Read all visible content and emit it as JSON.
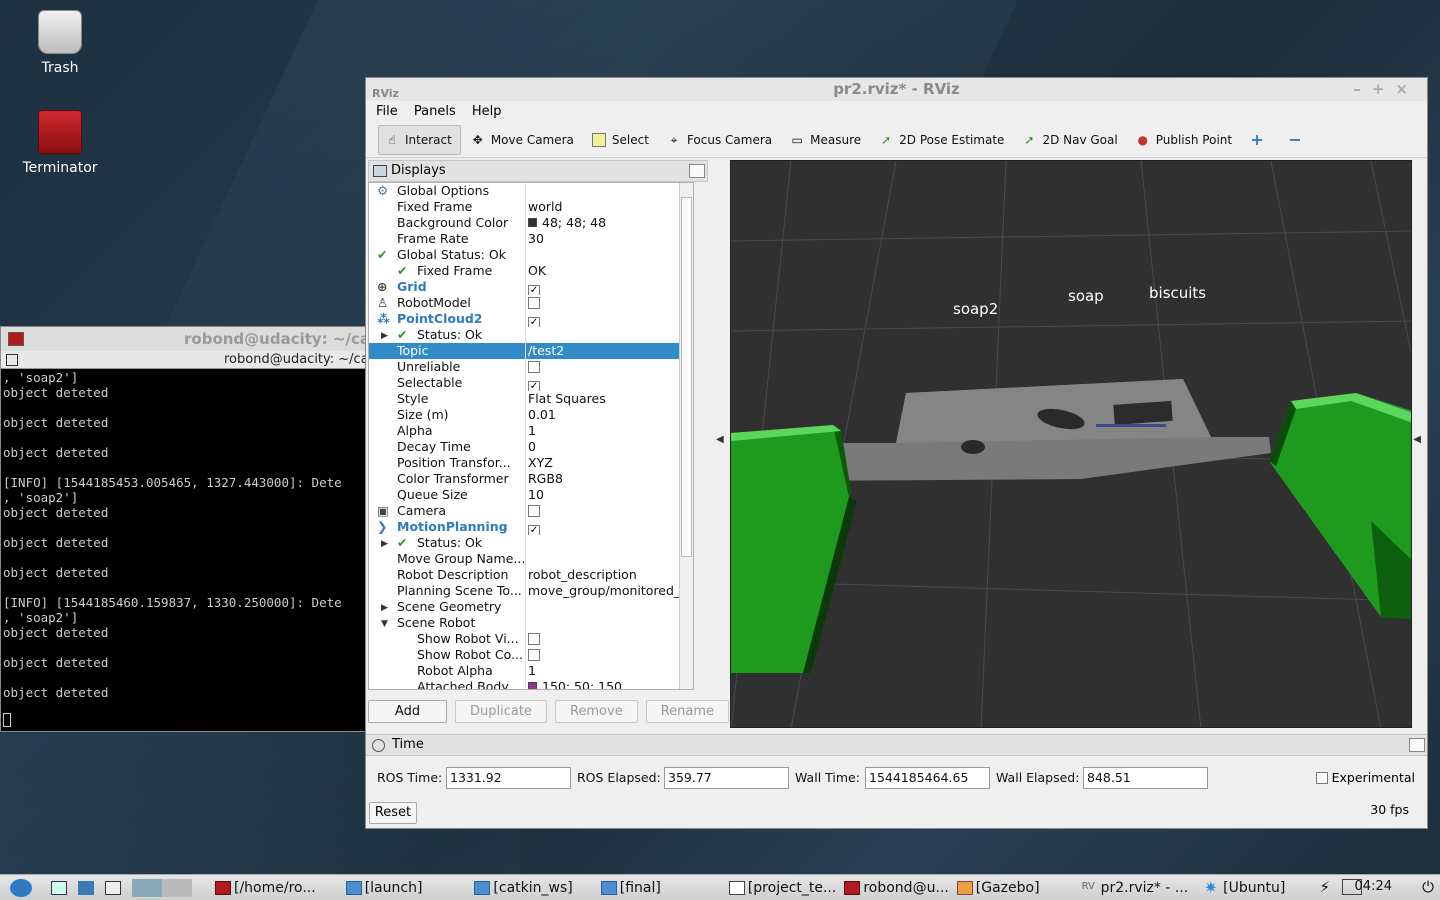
{
  "desktop": {
    "icons": [
      {
        "label": "Trash",
        "icon": "trash-icon"
      },
      {
        "label": "Terminator",
        "icon": "terminator-icon"
      }
    ]
  },
  "terminal": {
    "title": "robond@udacity: ~/ca",
    "tab_title": "robond@udacity: ~/ca",
    "lines": [
      ", 'soap2']",
      "object deteted",
      "",
      "object deteted",
      "",
      "object deteted",
      "",
      "[INFO] [1544185453.005465, 1327.443000]: Dete",
      ", 'soap2']",
      "object deteted",
      "",
      "object deteted",
      "",
      "object deteted",
      "",
      "[INFO] [1544185460.159837, 1330.250000]: Dete",
      ", 'soap2']",
      "object deteted",
      "",
      "object deteted",
      "",
      "object deteted"
    ]
  },
  "rviz": {
    "title": "pr2.rviz* - RViz",
    "menu": [
      "File",
      "Panels",
      "Help"
    ],
    "toolbar": [
      {
        "label": "Interact",
        "icon": "hand-cursor-icon",
        "active": true
      },
      {
        "label": "Move Camera",
        "icon": "move-camera-icon"
      },
      {
        "label": "Select",
        "icon": "select-icon"
      },
      {
        "label": "Focus Camera",
        "icon": "focus-camera-icon"
      },
      {
        "label": "Measure",
        "icon": "ruler-icon"
      },
      {
        "label": "2D Pose Estimate",
        "icon": "pose-estimate-icon"
      },
      {
        "label": "2D Nav Goal",
        "icon": "nav-goal-icon"
      },
      {
        "label": "Publish Point",
        "icon": "map-pin-icon"
      }
    ],
    "displays": {
      "title": "Displays",
      "rows": [
        {
          "k": "Global Options",
          "v": "",
          "indent": 1,
          "icon": "gear"
        },
        {
          "k": "Fixed Frame",
          "v": "world",
          "indent": 2
        },
        {
          "k": "Background Color",
          "v": "48; 48; 48",
          "indent": 2,
          "swatch": "#303030"
        },
        {
          "k": "Frame Rate",
          "v": "30",
          "indent": 2
        },
        {
          "k": "Global Status: Ok",
          "v": "",
          "indent": 1,
          "icon": "check"
        },
        {
          "k": "Fixed Frame",
          "v": "OK",
          "indent": 2,
          "icon": "check"
        },
        {
          "k": "Grid",
          "v": "",
          "indent": 1,
          "icon": "grid",
          "blue": true,
          "check": true
        },
        {
          "k": "RobotModel",
          "v": "",
          "indent": 1,
          "icon": "robot",
          "check": false
        },
        {
          "k": "PointCloud2",
          "v": "",
          "indent": 1,
          "icon": "cloud",
          "blue": true,
          "check": true,
          "expanded": true
        },
        {
          "k": "Status: Ok",
          "v": "",
          "indent": 2,
          "icon": "check",
          "arrow": "right"
        },
        {
          "k": "Topic",
          "v": "/test2",
          "indent": 2,
          "selected": true
        },
        {
          "k": "Unreliable",
          "v": "",
          "indent": 2,
          "check": false
        },
        {
          "k": "Selectable",
          "v": "",
          "indent": 2,
          "check": true
        },
        {
          "k": "Style",
          "v": "Flat Squares",
          "indent": 2
        },
        {
          "k": "Size (m)",
          "v": "0.01",
          "indent": 2
        },
        {
          "k": "Alpha",
          "v": "1",
          "indent": 2
        },
        {
          "k": "Decay Time",
          "v": "0",
          "indent": 2
        },
        {
          "k": "Position Transfor...",
          "v": "XYZ",
          "indent": 2
        },
        {
          "k": "Color Transformer",
          "v": "RGB8",
          "indent": 2
        },
        {
          "k": "Queue Size",
          "v": "10",
          "indent": 2
        },
        {
          "k": "Camera",
          "v": "",
          "indent": 1,
          "icon": "camera",
          "check": false
        },
        {
          "k": "MotionPlanning",
          "v": "",
          "indent": 1,
          "icon": "motion",
          "blue": true,
          "check": true
        },
        {
          "k": "Status: Ok",
          "v": "",
          "indent": 2,
          "icon": "check",
          "arrow": "right"
        },
        {
          "k": "Move Group Name...",
          "v": "",
          "indent": 2
        },
        {
          "k": "Robot Description",
          "v": "robot_description",
          "indent": 2
        },
        {
          "k": "Planning Scene To...",
          "v": "move_group/monitored_...",
          "indent": 2
        },
        {
          "k": "Scene Geometry",
          "v": "",
          "indent": 2,
          "arrow": "right"
        },
        {
          "k": "Scene Robot",
          "v": "",
          "indent": 2,
          "arrow": "down"
        },
        {
          "k": "Show Robot Vi...",
          "v": "",
          "indent": 3,
          "check": false
        },
        {
          "k": "Show Robot Co...",
          "v": "",
          "indent": 3,
          "check": false
        },
        {
          "k": "Robot Alpha",
          "v": "1",
          "indent": 3
        },
        {
          "k": "Attached Body...",
          "v": "150; 50; 150",
          "indent": 3,
          "swatch": "#963296"
        }
      ],
      "buttons": {
        "add": "Add",
        "duplicate": "Duplicate",
        "remove": "Remove",
        "rename": "Rename"
      }
    },
    "view_labels": [
      "soap2",
      "soap",
      "biscuits"
    ],
    "time": {
      "title": "Time",
      "ros_time_label": "ROS Time:",
      "ros_time": "1331.92",
      "ros_elapsed_label": "ROS Elapsed:",
      "ros_elapsed": "359.77",
      "wall_time_label": "Wall Time:",
      "wall_time": "1544185464.65",
      "wall_elapsed_label": "Wall Elapsed:",
      "wall_elapsed": "848.51",
      "experimental_label": "Experimental",
      "reset_label": "Reset",
      "fps": "30 fps"
    }
  },
  "taskbar": {
    "items": [
      {
        "label": "[/home/ro...",
        "icon": "terminal"
      },
      {
        "label": "[launch]",
        "icon": "folder"
      },
      {
        "label": "[catkin_ws]",
        "icon": "folder"
      },
      {
        "label": "[final]",
        "icon": "folder"
      },
      {
        "label": "[project_te...",
        "icon": "editor"
      },
      {
        "label": "robond@u...",
        "icon": "terminal"
      },
      {
        "label": "[Gazebo]",
        "icon": "gazebo"
      },
      {
        "label": "pr2.rviz* - ...",
        "icon": "rviz"
      },
      {
        "label": "[Ubuntu]",
        "icon": "ubuntu"
      }
    ],
    "clock": "04:24"
  }
}
